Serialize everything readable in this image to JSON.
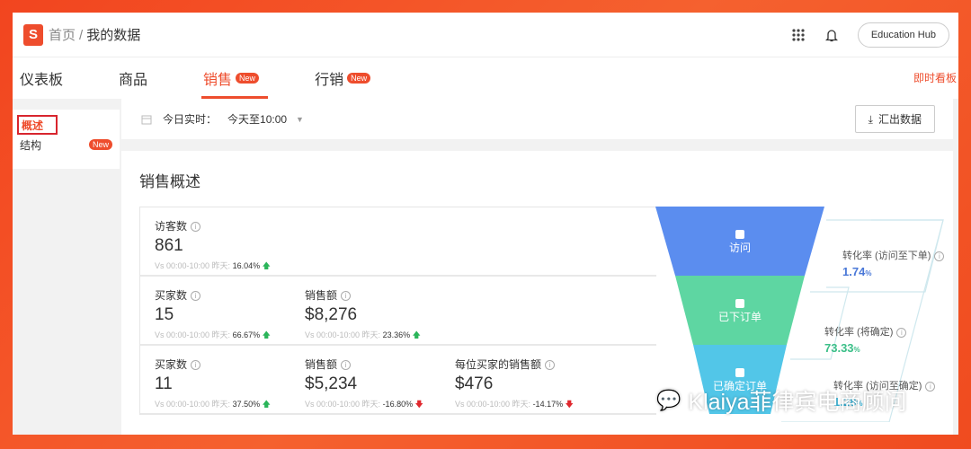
{
  "header": {
    "logo_letter": "S",
    "breadcrumb_home": "首页",
    "breadcrumb_sep": "/",
    "breadcrumb_current": "我的数据",
    "education_hub": "Education Hub"
  },
  "tabs": [
    {
      "label": "仪表板"
    },
    {
      "label": "商品"
    },
    {
      "label": "销售",
      "badge": "New"
    },
    {
      "label": "行销",
      "badge": "New"
    }
  ],
  "live_board": "即时看板",
  "sidebar": {
    "items": [
      {
        "label": "概述"
      },
      {
        "label": "结构",
        "badge": "New"
      }
    ]
  },
  "filter": {
    "label": "今日实时：",
    "value": "今天至10:00",
    "export": "汇出数据"
  },
  "overview": {
    "title": "销售概述",
    "compare_prefix": "Vs 00:00-10:00 昨天:",
    "rows": [
      [
        {
          "label": "访客数",
          "value": "861",
          "change": "16.04%",
          "dir": "up"
        }
      ],
      [
        {
          "label": "买家数",
          "value": "15",
          "change": "66.67%",
          "dir": "up"
        },
        {
          "label": "销售额",
          "value": "$8,276",
          "change": "23.36%",
          "dir": "up"
        }
      ],
      [
        {
          "label": "买家数",
          "value": "11",
          "change": "37.50%",
          "dir": "up"
        },
        {
          "label": "销售额",
          "value": "$5,234",
          "change": "-16.80%",
          "dir": "down"
        },
        {
          "label": "每位买家的销售额",
          "value": "$476",
          "change": "-14.17%",
          "dir": "down"
        }
      ]
    ]
  },
  "funnel": {
    "stages": [
      {
        "label": "访问",
        "color": "#5b8def"
      },
      {
        "label": "已下订单",
        "color": "#5ed6a2"
      },
      {
        "label": "已确定订单",
        "color": "#52c6e8"
      }
    ],
    "rates": [
      {
        "label": "转化率 (访问至下单)",
        "value": "1.74",
        "unit": "%",
        "color": "#4a78d8"
      },
      {
        "label": "转化率 (将确定)",
        "value": "73.33",
        "unit": "%",
        "color": "#3bbf88"
      },
      {
        "label": "转化率 (访问至确定)",
        "value": "1.28",
        "unit": "%",
        "color": "#35b6dc"
      }
    ]
  },
  "watermark": "Klaiya菲律宾电商顾问"
}
